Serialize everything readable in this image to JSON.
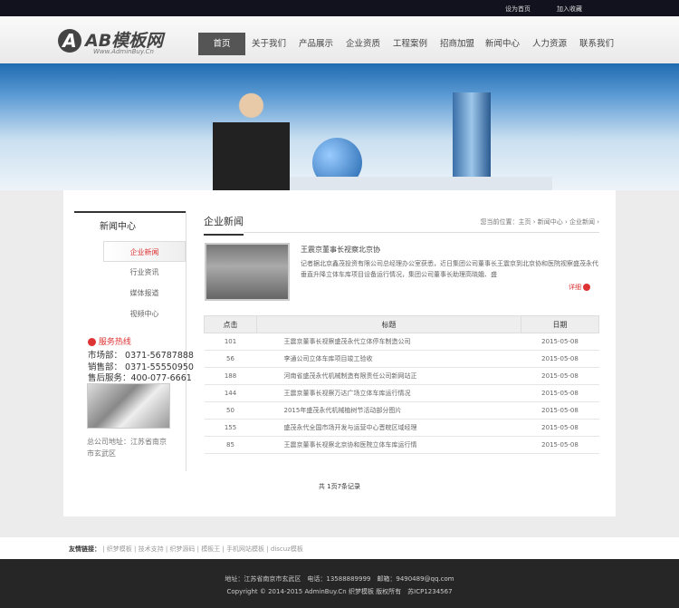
{
  "topbar": {
    "set_home": "设为首页",
    "favorite": "加入收藏"
  },
  "logo": {
    "mark": "A",
    "name": "AB模板网",
    "sub": "Www.AdminBuy.Cn"
  },
  "nav": [
    "首页",
    "关于我们",
    "产品展示",
    "企业资质",
    "工程案例",
    "招商加盟",
    "新闻中心",
    "人力资源",
    "联系我们"
  ],
  "sidebar": {
    "title": "新闻中心",
    "items": [
      "企业新闻",
      "行业资讯",
      "媒体报道",
      "视频中心"
    ],
    "hotline": "服务热线",
    "phones": [
      "市场部： 0371-56787888",
      "销售部： 0371-55550950",
      "售后服务：400-077-6661"
    ],
    "address": [
      "总公司地址：江苏省南京",
      "市玄武区"
    ]
  },
  "main": {
    "title": "企业新闻",
    "breadcrumb": "您当前位置：主页 › 新闻中心 › 企业新闻 ›",
    "featured": {
      "title": "王震京董事长视察北京协",
      "desc": "记者据北京鑫茂投资有限公司总经理办公室获悉，近日集团公司董事长王震京到北京协和医院视察盛茂永代垂直升降立体车库项目设备运行情况，集团公司董事长助理高晓娥、盛",
      "more": "详细"
    },
    "table": {
      "headers": [
        "点击",
        "标题",
        "日期"
      ],
      "rows": [
        [
          "101",
          "王震京董事长视察盛茂永代立体停车制造公司",
          "2015-05-08"
        ],
        [
          "56",
          "李通公司立体车库项目竣工验收",
          "2015-05-08"
        ],
        [
          "188",
          "河南省盛茂永代机械制造有限责任公司新网站正",
          "2015-05-08"
        ],
        [
          "144",
          "王震京董事长视察万达广场立体车库运行情况",
          "2015-05-08"
        ],
        [
          "50",
          "2015年盛茂永代机械植树节活动部分图片",
          "2015-05-08"
        ],
        [
          "155",
          "盛茂永代全国市场开发与运营中心晋皖区域经理",
          "2015-05-08"
        ],
        [
          "85",
          "王震京董事长视察北京协和医院立体车库运行情",
          "2015-05-08"
        ]
      ]
    },
    "pager": "共 1页7条记录"
  },
  "links": {
    "label": "友情链接：",
    "items": [
      "织梦模板",
      "技术支持",
      "织梦源码",
      "模板王",
      "手机网站模板",
      "discuz模板"
    ]
  },
  "footer": {
    "line1": "地址：江苏省南京市玄武区　电话：13588889999　邮箱：9490489@qq.com",
    "line2": "Copyright © 2014-2015 AdminBuy.Cn 织梦模板 版权所有　苏ICP1234567"
  }
}
